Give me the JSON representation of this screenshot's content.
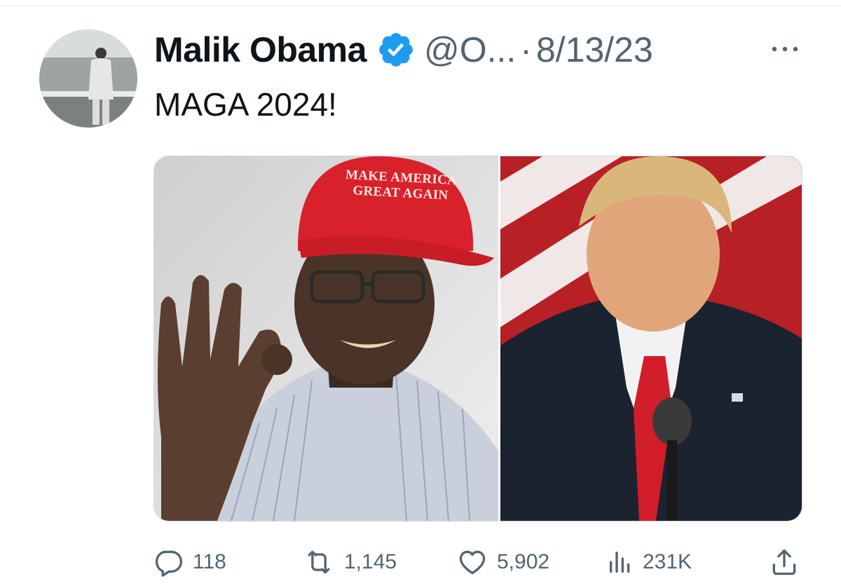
{
  "tweet": {
    "author_name": "Malik Obama",
    "handle": "@O...",
    "separator": "·",
    "date": "8/13/23",
    "text": "MAGA 2024!",
    "verified": true
  },
  "media": {
    "left_image": {
      "cap_line1": "MAKE AMERICA",
      "cap_line2": "GREAT AGAIN"
    }
  },
  "actions": {
    "replies": "118",
    "retweets": "1,145",
    "likes": "5,902",
    "views": "231K"
  },
  "icons": {
    "verified": "verified-badge-icon",
    "more": "more-icon",
    "reply": "reply-icon",
    "retweet": "retweet-icon",
    "like": "heart-icon",
    "views": "views-icon",
    "share": "share-icon"
  },
  "colors": {
    "text_primary": "#0f1419",
    "text_secondary": "#536471",
    "verified_blue": "#1d9bf0",
    "cap_red": "#d8212b"
  }
}
